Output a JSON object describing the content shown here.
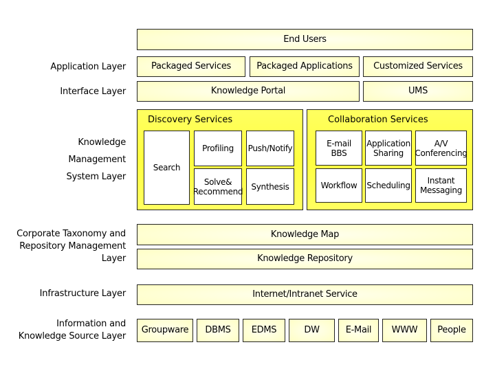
{
  "layers": {
    "application": "Application Layer",
    "interface": "Interface Layer",
    "kms": [
      "Knowledge",
      "Management",
      "System Layer"
    ],
    "taxonomy": [
      "Corporate Taxonomy  and",
      "Repository Management",
      "Layer"
    ],
    "infrastructure": "Infrastructure Layer",
    "sources": [
      "Information and",
      "Knowledge Source Layer"
    ]
  },
  "end_users": "End Users",
  "application": [
    "Packaged Services",
    "Packaged Applications",
    "Customized Services"
  ],
  "interface": [
    "Knowledge Portal",
    "UMS"
  ],
  "discovery": {
    "title": "Discovery Services",
    "items": [
      "Search",
      "Profiling",
      "Push/Notify",
      "Solve&\nRecommend",
      "Synthesis"
    ]
  },
  "collaboration": {
    "title": "Collaboration Services",
    "items": [
      "E-mail\nBBS",
      "Application\nSharing",
      "A/V\nConferencing",
      "Workflow",
      "Scheduling",
      "Instant\nMessaging"
    ]
  },
  "knowledge_map": "Knowledge Map",
  "knowledge_repository": "Knowledge Repository",
  "infrastructure": "Internet/Intranet Service",
  "sources": [
    "Groupware",
    "DBMS",
    "EDMS",
    "DW",
    "E-Mail",
    "WWW",
    "People"
  ],
  "colors": {
    "box": "#ffffc4",
    "service_group": "#ffff50",
    "border": "#222222"
  }
}
